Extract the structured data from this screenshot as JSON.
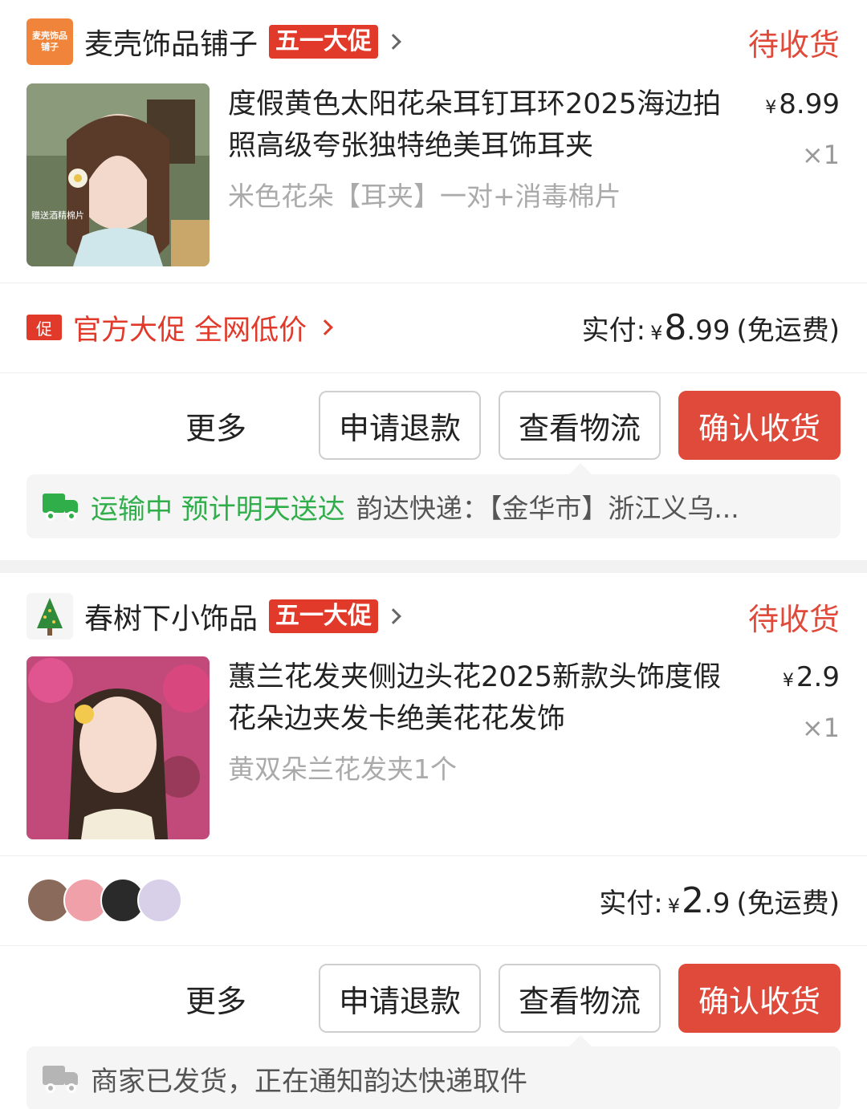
{
  "orders": [
    {
      "shop": {
        "name": "麦壳饰品铺子",
        "logo_lines": [
          "麦壳饰品",
          "铺子"
        ],
        "badge": "五一大促"
      },
      "status": "待收货",
      "product": {
        "title": "度假黄色太阳花朵耳钉耳环2025海边拍照高级夸张独特绝美耳饰耳夹",
        "spec": "米色花朵【耳夹】一对+消毒棉片",
        "image_caption": "赠送酒精棉片",
        "currency": "¥",
        "price": "8.99",
        "qty": "×1"
      },
      "promo": {
        "icon": "促",
        "text": "官方大促 全网低价"
      },
      "paid": {
        "label": "实付:",
        "currency": "¥",
        "int": "8",
        "dec": ".99",
        "shipping": "(免运费)"
      },
      "actions": {
        "more": "更多",
        "refund": "申请退款",
        "logistics": "查看物流",
        "confirm": "确认收货"
      },
      "logistics": {
        "status": "运输中 预计明天送达",
        "detail": "韵达快递：【金华市】浙江义乌..."
      }
    },
    {
      "shop": {
        "name": "春树下小饰品",
        "badge": "五一大促"
      },
      "status": "待收货",
      "product": {
        "title": "蕙兰花发夹侧边头花2025新款头饰度假花朵边夹发卡绝美花花发饰",
        "spec": "黄双朵兰花发夹1个",
        "currency": "¥",
        "price": "2.9",
        "qty": "×1"
      },
      "paid": {
        "label": "实付:",
        "currency": "¥",
        "int": "2",
        "dec": ".9",
        "shipping": "(免运费)"
      },
      "actions": {
        "more": "更多",
        "refund": "申请退款",
        "logistics": "查看物流",
        "confirm": "确认收货"
      },
      "logistics": {
        "detail": "商家已发货，正在通知韵达快递取件"
      }
    }
  ],
  "colors": {
    "accent_red": "#e04a3a",
    "green": "#2fae4a",
    "gray_text": "#aaaaaa"
  }
}
